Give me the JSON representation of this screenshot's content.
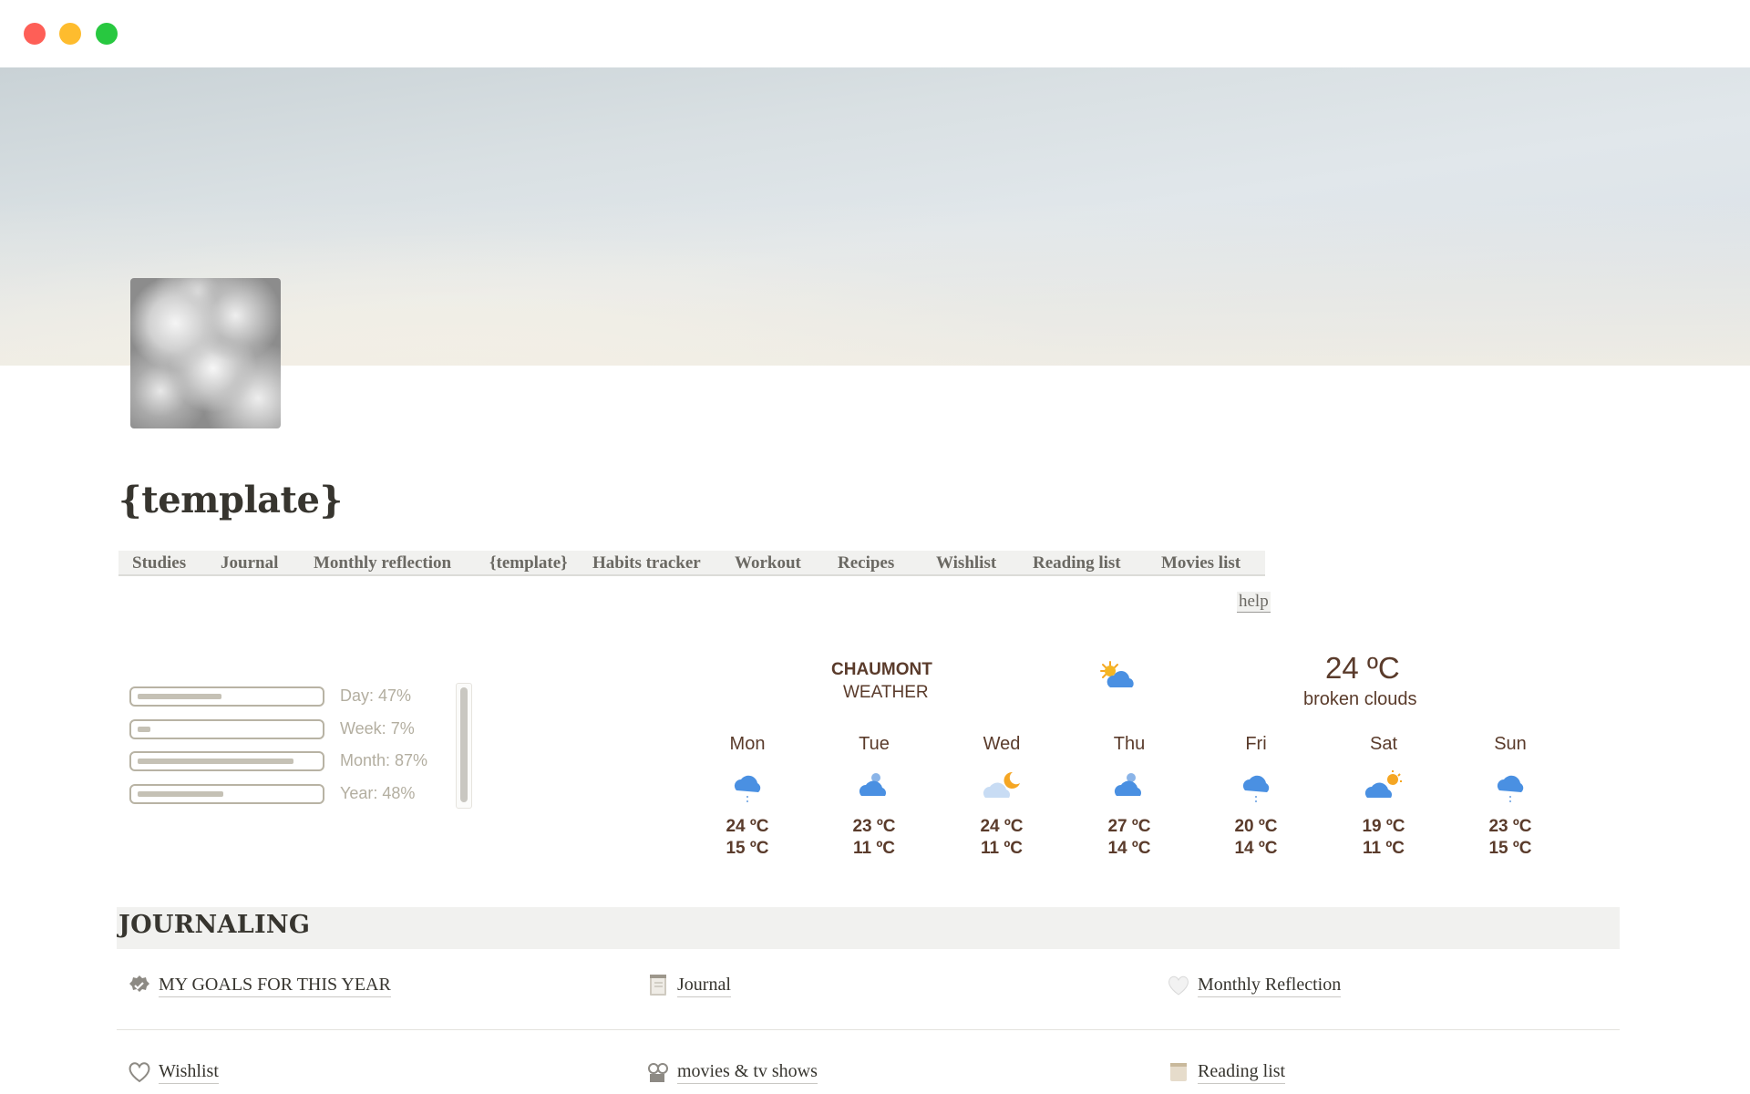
{
  "window": {
    "controls": [
      "close",
      "minimize",
      "zoom"
    ]
  },
  "page": {
    "title": "{template}"
  },
  "nav": {
    "items": [
      {
        "label": "Studies"
      },
      {
        "label": "Journal"
      },
      {
        "label": "Monthly reflection"
      },
      {
        "label": "{template}"
      },
      {
        "label": "Habits tracker"
      },
      {
        "label": "Workout"
      },
      {
        "label": "Recipes"
      },
      {
        "label": "Wishlist"
      },
      {
        "label": "Reading list"
      },
      {
        "label": "Movies list"
      }
    ],
    "help": "help"
  },
  "progress": {
    "items": [
      {
        "label": "Day: 47%",
        "fraction": 0.47
      },
      {
        "label": "Week: 7%",
        "fraction": 0.07
      },
      {
        "label": "Month: 87%",
        "fraction": 0.87
      },
      {
        "label": "Year: 48%",
        "fraction": 0.48
      }
    ]
  },
  "weather": {
    "city": "CHAUMONT",
    "subtitle": "WEATHER",
    "current_icon": "sun-behind-cloud-icon",
    "current_temp": "24 ºC",
    "description": "broken clouds",
    "days": [
      {
        "name": "Mon",
        "icon": "rain-cloud-icon",
        "high": "24 ºC",
        "low": "15 ºC"
      },
      {
        "name": "Tue",
        "icon": "cloudy-icon",
        "high": "23 ºC",
        "low": "11 ºC"
      },
      {
        "name": "Wed",
        "icon": "moon-cloud-icon",
        "high": "24 ºC",
        "low": "11 ºC"
      },
      {
        "name": "Thu",
        "icon": "cloudy-icon",
        "high": "27 ºC",
        "low": "14 ºC"
      },
      {
        "name": "Fri",
        "icon": "rain-cloud-icon",
        "high": "20 ºC",
        "low": "14 ºC"
      },
      {
        "name": "Sat",
        "icon": "sun-cloud-icon",
        "high": "19 ºC",
        "low": "11 ºC"
      },
      {
        "name": "Sun",
        "icon": "rain-cloud-icon",
        "high": "23 ºC",
        "low": "15 ºC"
      }
    ]
  },
  "journaling": {
    "title": "JOURNALING",
    "links": [
      {
        "label": "MY GOALS FOR THIS YEAR",
        "icon": "verified-badge-icon"
      },
      {
        "label": "Journal",
        "icon": "notebook-icon"
      },
      {
        "label": "Monthly Reflection",
        "icon": "white-heart-icon"
      },
      {
        "label": "Wishlist",
        "icon": "heart-outline-icon"
      },
      {
        "label": "movies & tv shows",
        "icon": "film-reel-icon"
      },
      {
        "label": "Reading list",
        "icon": "book-icon"
      }
    ]
  },
  "colors": {
    "weather_text": "#5a3b2b",
    "nav_bg": "#f1f1ef",
    "progress_track": "#b8b3a4",
    "progress_label": "#b3aea0"
  }
}
